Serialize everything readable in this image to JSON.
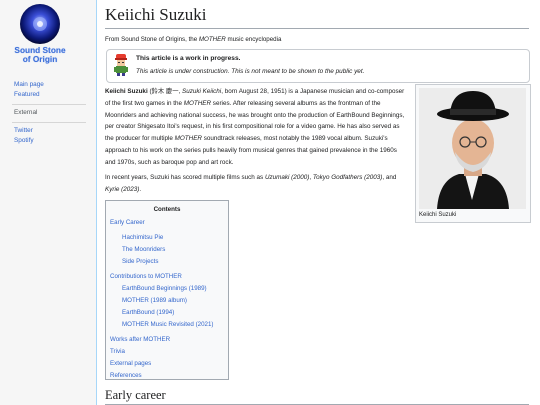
{
  "sidebar": {
    "logo_line1": "Sound Stone",
    "logo_line2": "of Origin",
    "links": [
      "Main page",
      "Featured"
    ],
    "external_heading": "External",
    "external_links": [
      "Twitter",
      "Spotify"
    ]
  },
  "page": {
    "title": "Keiichi Suzuki",
    "tagline_prefix": "From Sound Stone of Origins, the ",
    "tagline_em": "MOTHER",
    "tagline_suffix": " music encyclopedia"
  },
  "notice": {
    "title": "This article is a work in progress.",
    "body": "This article is under construction. This is not meant to be shown to the public yet."
  },
  "intro": {
    "name_bold": "Keiichi Suzuki",
    "native_open": " (鈴木 慶一, ",
    "romaji": "Suzuki Keiichi",
    "text1": ", born August 28, 1951) is a Japanese musician and co-composer of the first two games in the ",
    "mother1": "MOTHER",
    "text2": " series. After releasing several albums as the frontman of the Moonriders and achieving national success, he was brought onto the production of EarthBound Beginnings, per creator Shigesato Itoi's request, in his first compositional role for a video game. He has also served as the producer for multiple ",
    "mother2": "MOTHER",
    "text3": " soundtrack releases, most notably the 1989 vocal album. Suzuki's approach to his work on the series pulls heavily from musical genres that gained prevalence in the 1960s and 1970s, such as baroque pop and art rock."
  },
  "intro2": {
    "text1": "In recent years, Suzuki has scored multiple films such as ",
    "film1": "Uzumaki (2000)",
    "sep1": ", ",
    "film2": "Tokyo Godfathers (2003)",
    "sep2": ", and ",
    "film3": "Kyrie (2023)",
    "end": "."
  },
  "infobox": {
    "caption": "Keiichi Suzuki"
  },
  "toc": {
    "title": "Contents",
    "items": [
      {
        "label": "Early Career"
      },
      {
        "label": "Hachimitsu Pie"
      },
      {
        "label": "The Moonriders"
      },
      {
        "label": "Side Projects"
      },
      {
        "label": "Contributions to MOTHER"
      },
      {
        "label": "EarthBound Beginnings (1989)"
      },
      {
        "label": "MOTHER (1989 album)"
      },
      {
        "label": "EarthBound (1994)"
      },
      {
        "label": "MOTHER Music Revisited (2021)"
      },
      {
        "label": "Works after MOTHER"
      },
      {
        "label": "Trivia"
      },
      {
        "label": "External pages"
      },
      {
        "label": "References"
      }
    ]
  },
  "section": {
    "early_career": "Early career"
  },
  "colors": {
    "link": "#3366cc",
    "border": "#a2a9b1",
    "accent": "#a7d7f9"
  }
}
